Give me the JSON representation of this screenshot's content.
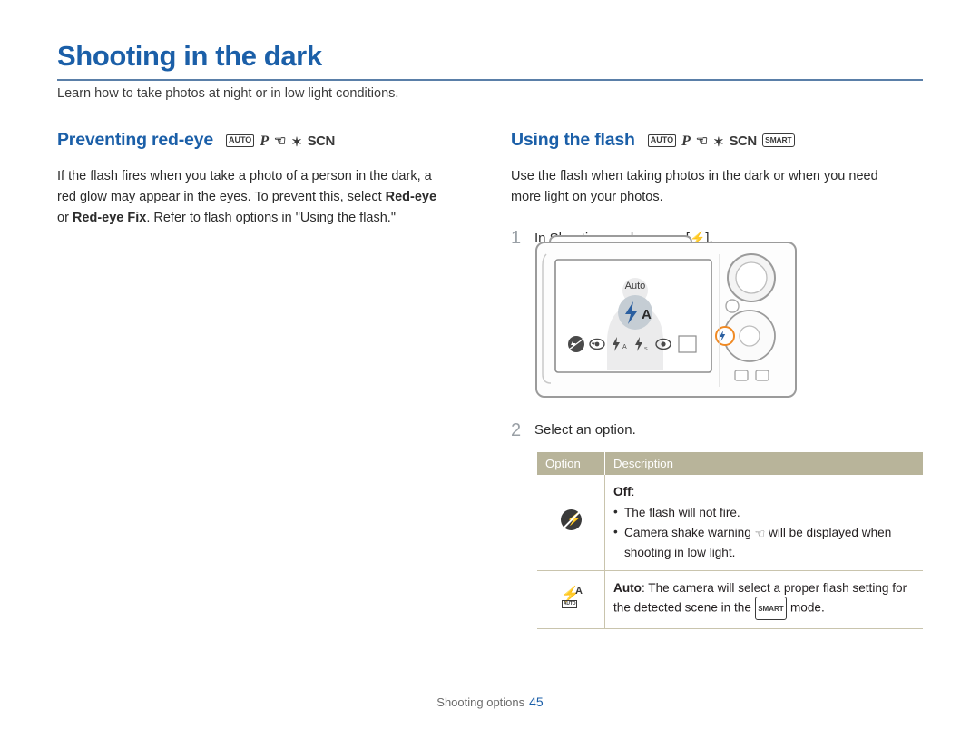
{
  "page": {
    "title": "Shooting in the dark",
    "subtitle": "Learn how to take photos at night or in low light conditions.",
    "footer_label": "Shooting options",
    "footer_page": "45"
  },
  "left_section": {
    "heading": "Preventing red-eye",
    "mode_icons": [
      "AUTO",
      "P",
      "dual-is",
      "night",
      "SCN"
    ],
    "paragraph_1": "If the flash fires when you take a photo of a person in the dark, a",
    "paragraph_2_pre": "red glow may appear in the eyes. To prevent this, select ",
    "paragraph_2_bold": "Red-eye",
    "paragraph_3_pre": "or ",
    "paragraph_3_bold": "Red-eye Fix",
    "paragraph_3_post": ". Refer to flash options in \"Using the flash.\""
  },
  "right_section": {
    "heading": "Using the flash",
    "mode_icons": [
      "AUTO",
      "P",
      "dual-is",
      "night",
      "SCN",
      "SMART"
    ],
    "paragraph_1": "Use the flash when taking photos in the dark or when you need",
    "paragraph_2": "more light on your photos.",
    "steps": [
      {
        "num": "1",
        "text_pre": "In Shooting mode, press [",
        "icon": "flash-icon",
        "text_post": "]."
      },
      {
        "num": "2",
        "text": "Select an option."
      }
    ]
  },
  "camera": {
    "screen_mode_label": "Auto",
    "flash_strip_icons": [
      "flash-off",
      "red-eye",
      "fill-in",
      "slow-sync",
      "red-eye-fix",
      "blank"
    ],
    "selected_button_icon": "flash-auto"
  },
  "table": {
    "headers": [
      "Option",
      "Description"
    ],
    "rows": [
      {
        "icon": "flash-off-icon",
        "label": "Off",
        "label_suffix": ":",
        "bullets": [
          "The flash will not fire.",
          "Camera shake warning ( ) will be displayed when shooting in low light."
        ],
        "bullet_2_pre": "Camera shake warning",
        "bullet_2_mid": "will be displayed when",
        "bullet_2_end": "shooting in low light."
      },
      {
        "icon": "flash-auto-icon",
        "label": "Auto",
        "text_pre": ": The camera will select a proper flash setting for",
        "text_second_pre": "the detected scene in the",
        "text_second_post": "mode."
      }
    ]
  },
  "colors": {
    "heading_blue": "#1b5fa8",
    "table_header_bg": "#b8b49a",
    "rule": "#5a7fa8"
  }
}
